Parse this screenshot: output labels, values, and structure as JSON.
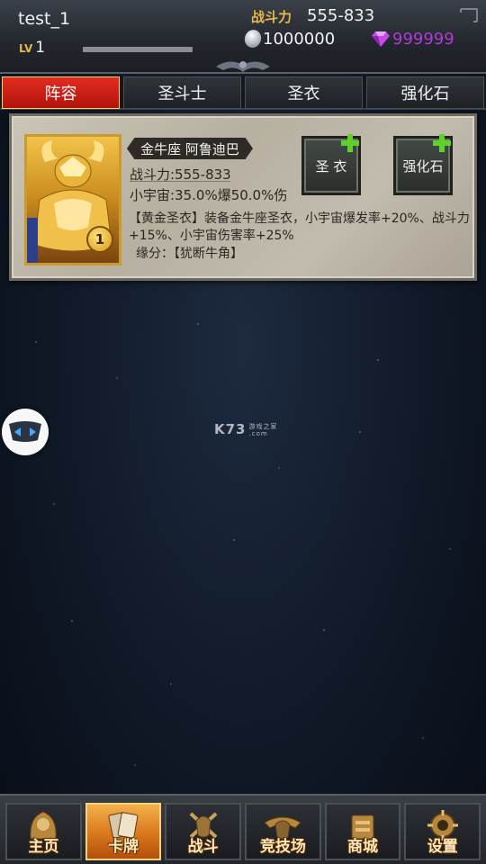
{
  "header": {
    "username": "test_1",
    "level_tag": "LV",
    "level": "1",
    "exp_progress": 0,
    "power_label": "战斗力",
    "power_value": "555-833",
    "silver_value": "1000000",
    "gem_value": "999999",
    "gem_color": "#b03ad8"
  },
  "tabs": [
    {
      "label": "阵容",
      "active": true
    },
    {
      "label": "圣斗士",
      "active": false
    },
    {
      "label": "圣衣",
      "active": false
    },
    {
      "label": "强化石",
      "active": false
    }
  ],
  "hero": {
    "name": "金牛座 阿鲁迪巴",
    "power": "战斗力:555-833",
    "cosmos": "小宇宙:35.0%爆50.0%伤",
    "description": "【黄金圣衣】装备金牛座圣衣，小宇宙爆发率+20%、战斗力+15%、小宇宙伤害率+25%",
    "bond": "缘分：【犹断牛角】",
    "star_level": "1",
    "armor_button": "圣 衣",
    "stone_button": "强化石"
  },
  "watermark": {
    "main": "K73",
    "sub": "游戏之家",
    "domain": ".com"
  },
  "bottom_nav": [
    {
      "label": "主页",
      "icon": "home-icon",
      "active": false
    },
    {
      "label": "卡牌",
      "icon": "cards-icon",
      "active": true
    },
    {
      "label": "战斗",
      "icon": "battle-icon",
      "active": false
    },
    {
      "label": "竞技场",
      "icon": "arena-icon",
      "active": false
    },
    {
      "label": "商城",
      "icon": "shop-icon",
      "active": false
    },
    {
      "label": "设置",
      "icon": "settings-icon",
      "active": false
    }
  ],
  "colors": {
    "accent_gold": "#e8b64a",
    "tab_active": "#d21e14",
    "nav_active": "#e08a24"
  }
}
